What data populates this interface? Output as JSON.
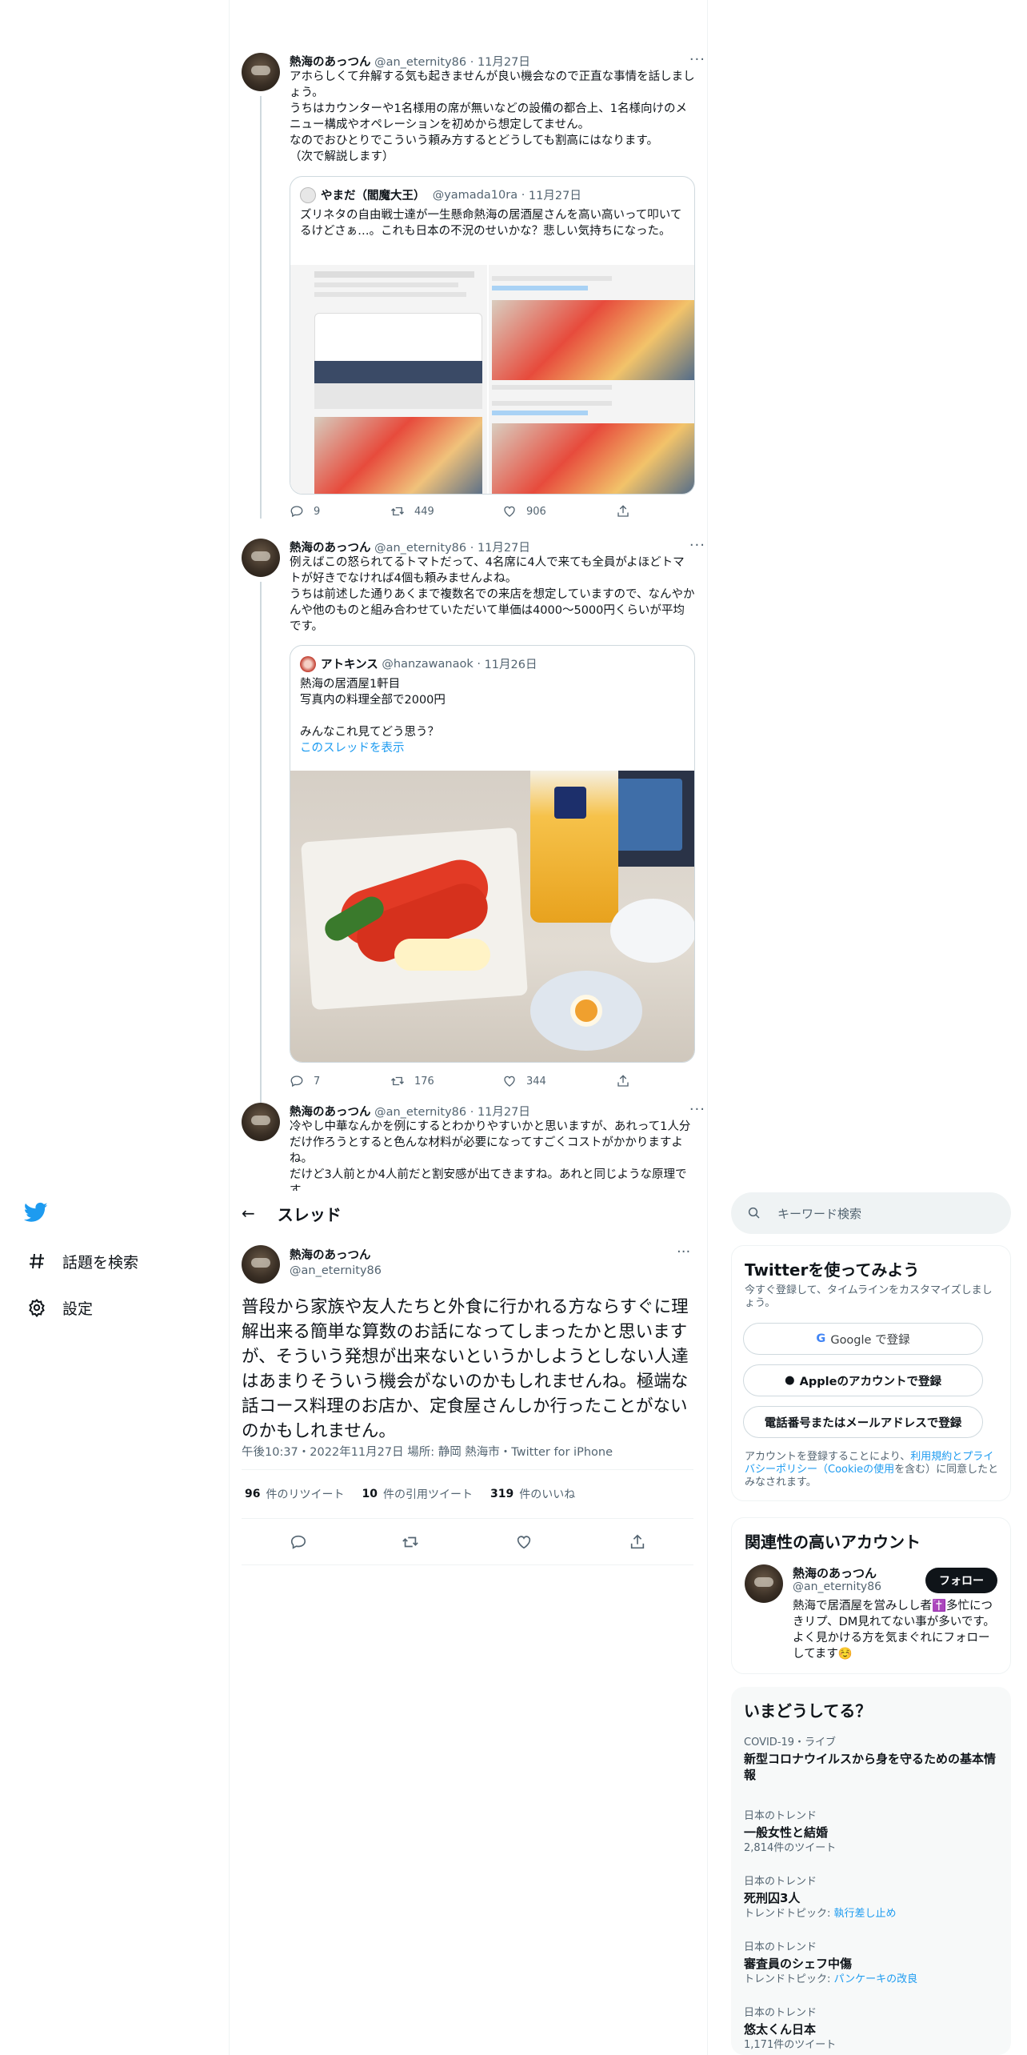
{
  "colors": {
    "accent": "#1d9bf0",
    "text": "#0f1419",
    "secondary": "#536471",
    "border": "#eff3f4"
  },
  "nav": {
    "logo_icon": "twitter-bird-icon",
    "explore_label": "話題を検索",
    "settings_label": "設定"
  },
  "tweets": [
    {
      "name": "熱海のあっつん",
      "handle": "@an_eternity86",
      "date": "11月27日",
      "text": "アホらしくて弁解する気も起きませんが良い機会なので正直な事情を話しましょう。\nうちはカウンターや1名様用の席が無いなどの設備の都合上、1名様向けのメニュー構成やオペレーションを初めから想定してません。\nなのでおひとりでこういう頼み方するとどうしても割高にはなります。\n（次で解説します）",
      "quote": {
        "name": "やまだ（閻魔大王）",
        "handle": "@yamada10ra",
        "date": "11月27日",
        "text": "ズリネタの自由戦士達が一生懸命熱海の居酒屋さんを高い高いって叩いてるけどさぁ…。これも日本の不況のせいかな？悲しい気持ちになった。"
      },
      "replies": "9",
      "retweets": "449",
      "likes": "906"
    },
    {
      "name": "熱海のあっつん",
      "handle": "@an_eternity86",
      "date": "11月27日",
      "text": "例えばこの怒られてるトマトだって、4名席に4人で来ても全員がよほどトマトが好きでなければ4個も頼みませんよね。\nうちは前述した通りあくまで複数名での来店を想定していますので、なんやかんや他のものと組み合わせていただいて単価は4000～5000円くらいが平均です。",
      "quote": {
        "name": "アトキンス",
        "handle": "@hanzawanaok",
        "date": "11月26日",
        "text": "熱海の居酒屋1軒目\n写真内の料理全部で2000円\n\nみんなこれ見てどう思う？",
        "link": "このスレッドを表示"
      },
      "replies": "7",
      "retweets": "176",
      "likes": "344"
    },
    {
      "name": "熱海のあっつん",
      "handle": "@an_eternity86",
      "date": "11月27日",
      "text": "冷やし中華なんかを例にするとわかりやすいかと思いますが、あれって1人分だけ作ろうとすると色んな材料が必要になってすごくコストがかかりますよね。\nだけど3人前とか4人前だと割安感が出てきますね。あれと同じような原理です。"
    }
  ],
  "thread": {
    "back_icon": "arrow-left-icon",
    "title": "スレッド",
    "name": "熱海のあっつん",
    "handle": "@an_eternity86",
    "text": "普段から家族や友人たちと外食に行かれる方ならすぐに理解出来る簡単な算数のお話になってしまったかと思いますが、そういう発想が出来ないというかしようとしない人達はあまりそういう機会がないのかもしれませんね。極端な話コース料理のお店か、定食屋さんしか行ったことがないのかもしれません。",
    "meta": "午後10:37・2022年11月27日 場所: 静岡 熱海市・Twitter for iPhone",
    "retweets_count": "96",
    "retweets_label": "件のリツイート",
    "quotes_count": "10",
    "quotes_label": "件の引用ツイート",
    "likes_count": "319",
    "likes_label": "件のいいね"
  },
  "search": {
    "placeholder": "キーワード検索"
  },
  "signup": {
    "title": "Twitterを使ってみよう",
    "subtitle": "今すぐ登録して、タイムラインをカスタマイズしましょう。",
    "google": "Google で登録",
    "apple": "Appleのアカウントで登録",
    "phone": "電話番号またはメールアドレスで登録",
    "terms_prefix": "アカウントを登録することにより、",
    "terms_link": "利用規約とプライバシーポリシー（Cookieの使用",
    "terms_suffix": "を含む）に同意したとみなされます。"
  },
  "related": {
    "title": "関連性の高いアカウント",
    "name": "熱海のあっつん",
    "handle": "@an_eternity86",
    "follow": "フォロー",
    "bio": "熱海で居酒屋を営みしし者✝️多忙につきリプ、DM見れてない事が多いです。よく見かける方を気まぐれにフォローしてます☺️"
  },
  "trends": {
    "title": "いまどうしてる？",
    "items": [
      {
        "category": "COVID-19・ライブ",
        "name": "新型コロナウイルスから身を守るための基本情報",
        "sub": "",
        "sub_prefix": "",
        "sub_link": ""
      },
      {
        "category": "日本のトレンド",
        "name": "一般女性と結婚",
        "sub": "2,814件のツイート",
        "sub_prefix": "",
        "sub_link": ""
      },
      {
        "category": "日本のトレンド",
        "name": "死刑囚3人",
        "sub": "",
        "sub_prefix": "トレンドトピック: ",
        "sub_link": "執行差し止め"
      },
      {
        "category": "日本のトレンド",
        "name": "審査員のシェフ中傷",
        "sub": "",
        "sub_prefix": "トレンドトピック: ",
        "sub_link": "パンケーキの改良"
      },
      {
        "category": "日本のトレンド",
        "name": "悠太くん日本",
        "sub": "1,171件のツイート",
        "sub_prefix": "",
        "sub_link": ""
      }
    ]
  }
}
